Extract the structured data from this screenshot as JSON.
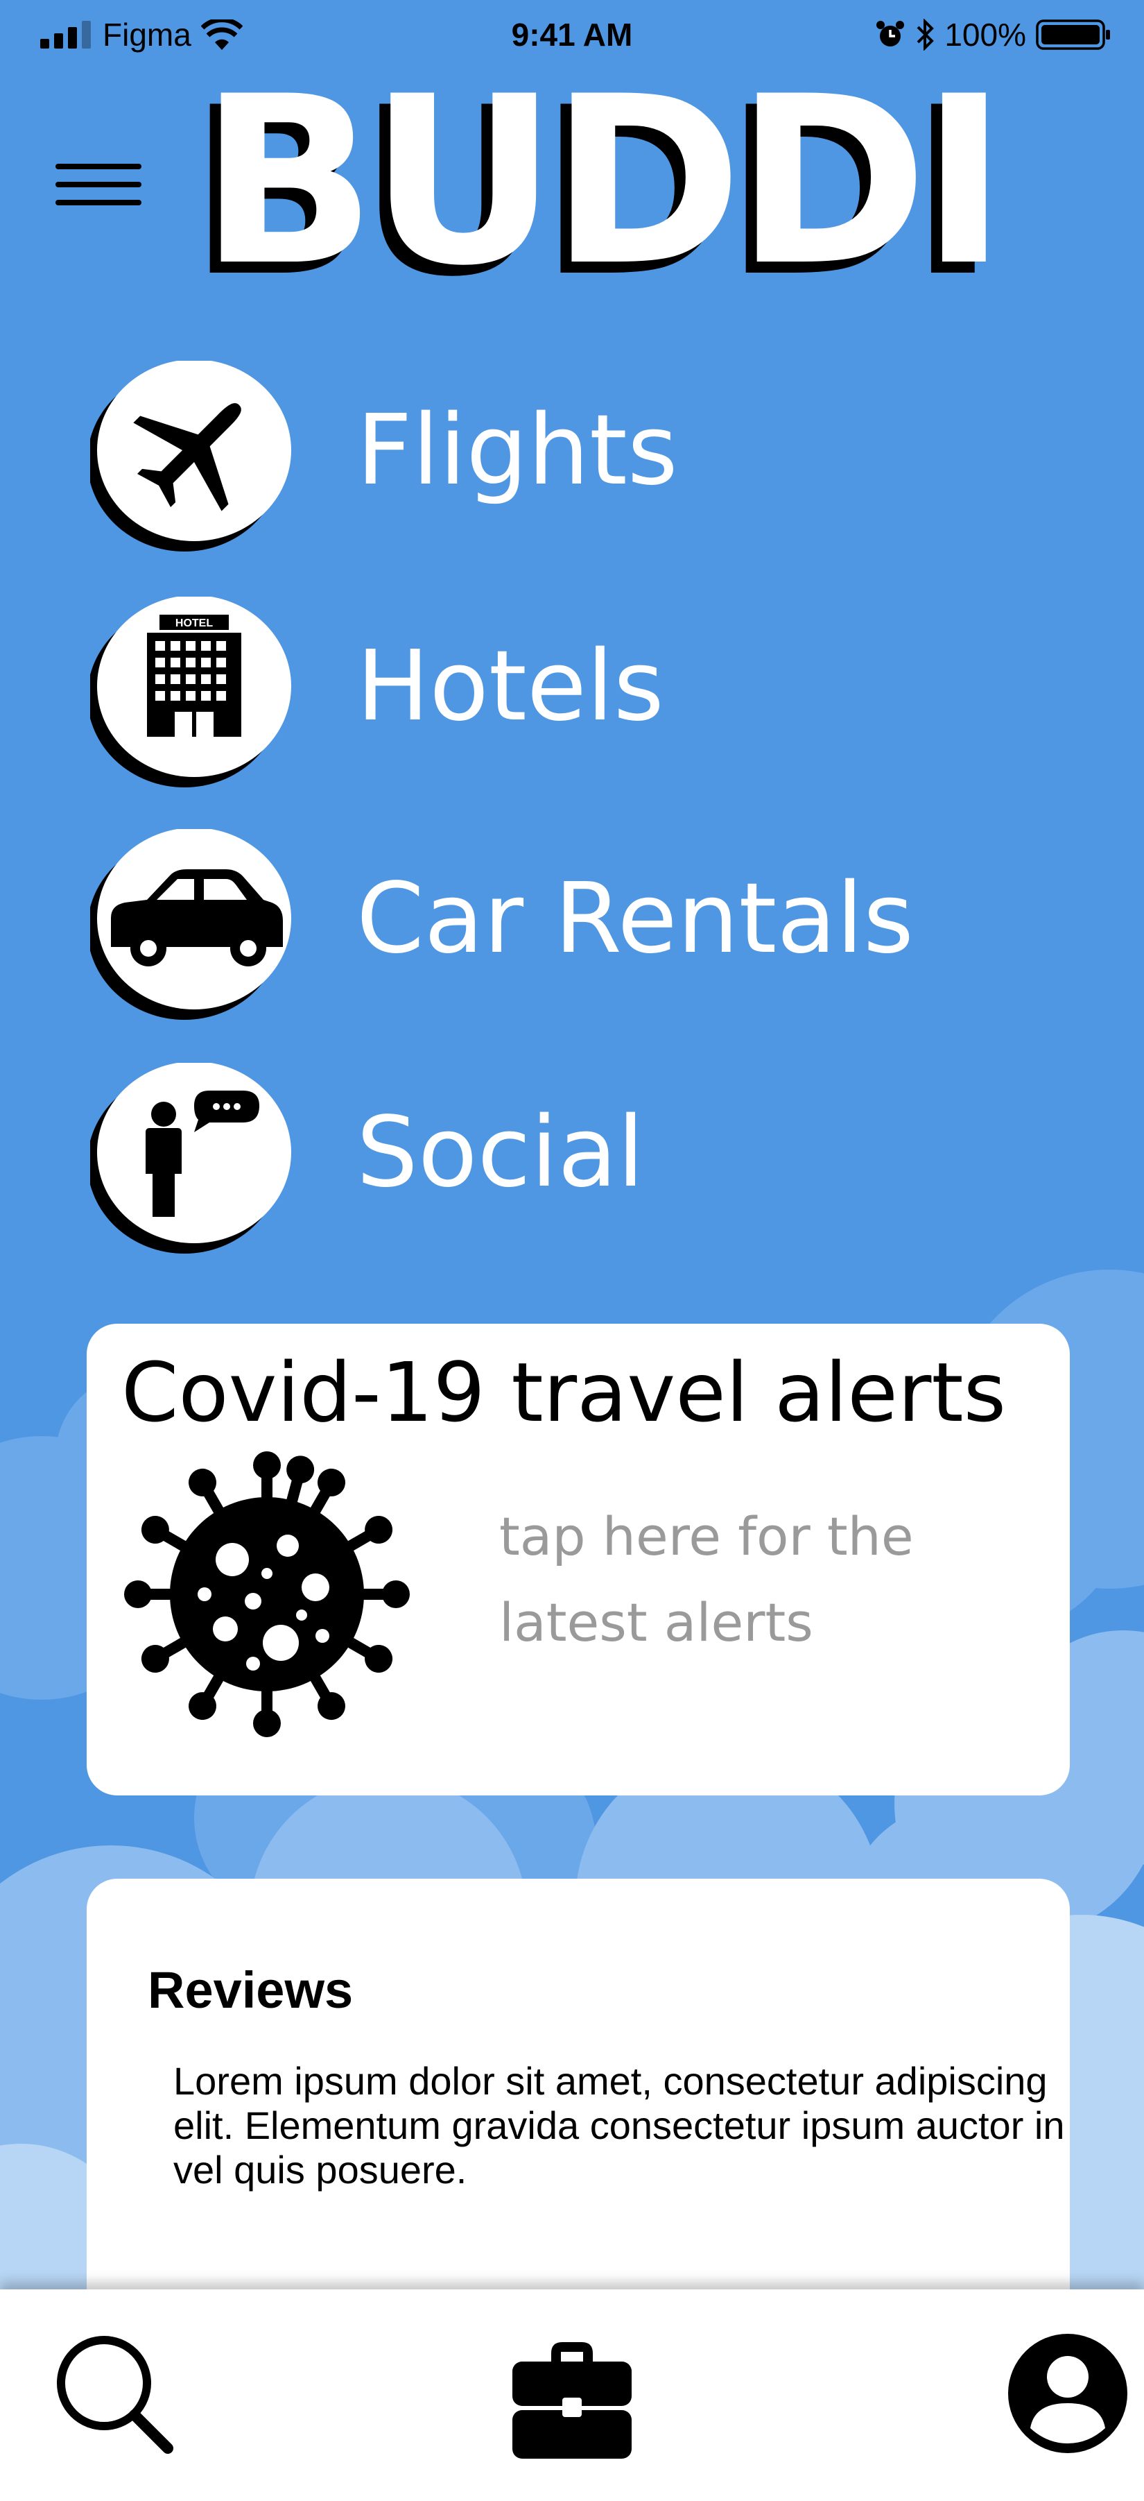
{
  "status_bar": {
    "carrier": "Figma",
    "time": "9:41 AM",
    "battery": "100%",
    "icons": [
      "signal-icon",
      "wifi-icon",
      "alarm-icon",
      "bluetooth-icon",
      "battery-icon"
    ]
  },
  "header": {
    "logo": "BUDDI",
    "menu_icon": "hamburger-menu-icon"
  },
  "categories": [
    {
      "label": "Flights",
      "icon": "airplane-icon"
    },
    {
      "label": "Hotels",
      "icon": "hotel-building-icon",
      "icon_sign": "HOTEL"
    },
    {
      "label": "Car Rentals",
      "icon": "car-icon"
    },
    {
      "label": "Social",
      "icon": "person-chat-icon"
    }
  ],
  "covid_card": {
    "title": "Covid-19 travel alerts",
    "cta": "tap here for the latest alerts",
    "icon": "virus-icon"
  },
  "reviews": {
    "title": "Reviews",
    "body": "Lorem ipsum dolor sit amet, consectetur adipiscing elit. Elementum gravida consectetur ipsum auctor in vel quis posuere."
  },
  "tab_bar": {
    "items": [
      {
        "name": "search",
        "icon": "search-icon"
      },
      {
        "name": "trips",
        "icon": "briefcase-icon"
      },
      {
        "name": "profile",
        "icon": "user-icon"
      }
    ]
  },
  "colors": {
    "background": "#4f97e3",
    "card": "#ffffff",
    "text_dark": "#000000",
    "text_muted": "#9a9a9a"
  }
}
